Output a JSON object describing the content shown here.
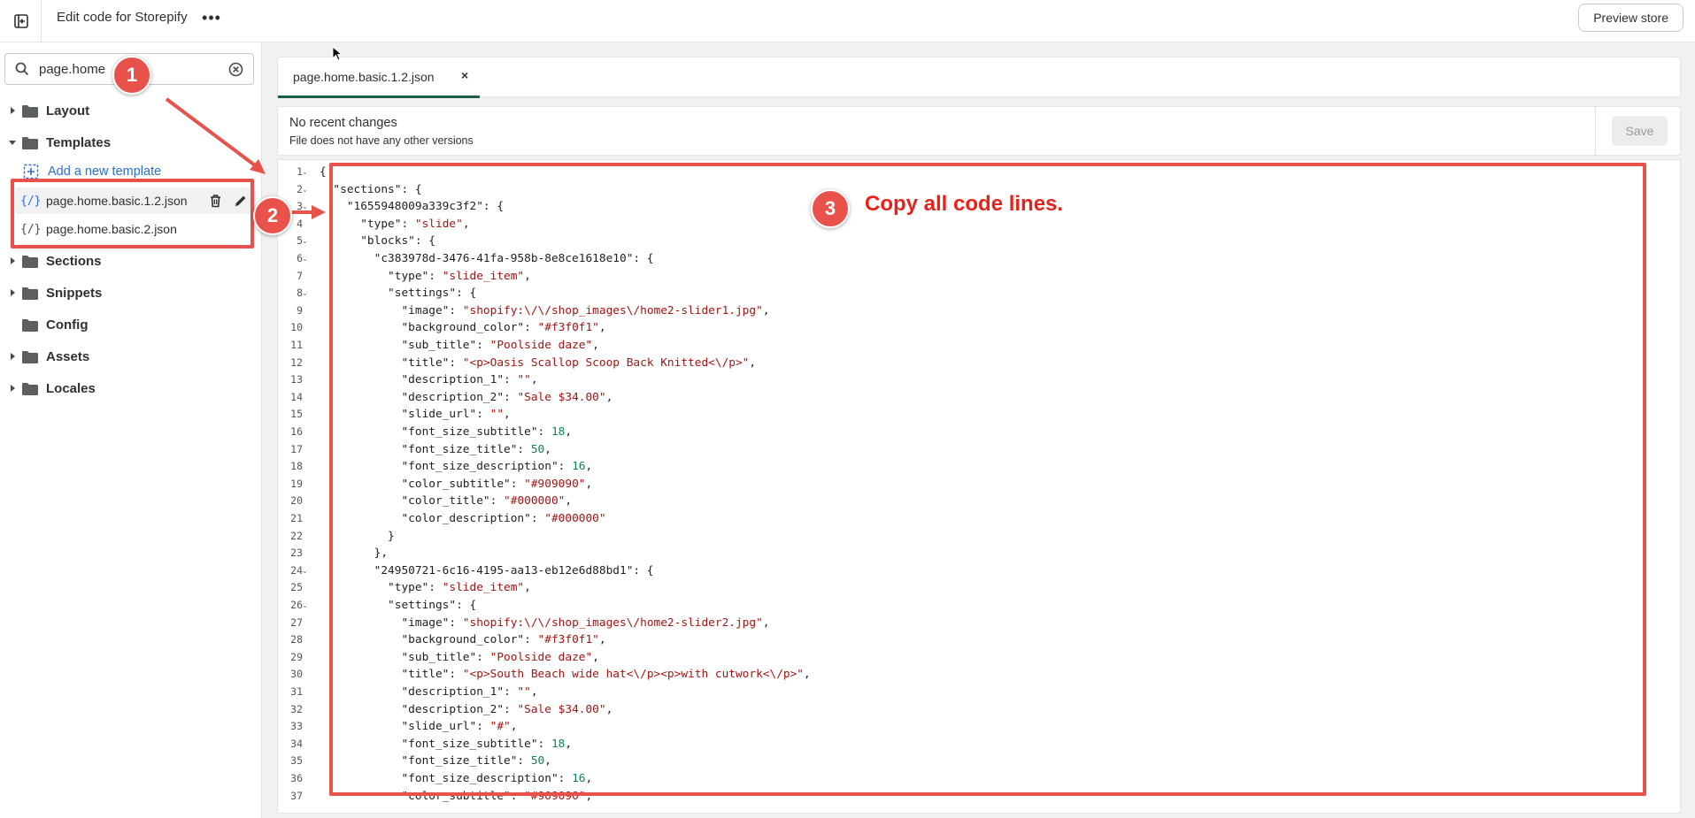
{
  "topbar": {
    "title": "Edit code for Storepify",
    "more_label": "•••",
    "preview_label": "Preview store"
  },
  "sidebar": {
    "search_value": "page.home",
    "folders": [
      {
        "label": "Layout",
        "expanded": false
      },
      {
        "label": "Templates",
        "expanded": true
      },
      {
        "label": "Sections",
        "expanded": false
      },
      {
        "label": "Snippets",
        "expanded": false
      },
      {
        "label": "Config",
        "expanded": false
      },
      {
        "label": "Assets",
        "expanded": false
      },
      {
        "label": "Locales",
        "expanded": false
      }
    ],
    "add_template_label": "Add a new template",
    "files": [
      {
        "icon": "{/}",
        "label": "page.home.basic.1.2.json",
        "active": true
      },
      {
        "icon": "{/}",
        "label": "page.home.basic.2.json",
        "active": false
      }
    ]
  },
  "editor": {
    "tab_label": "page.home.basic.1.2.json",
    "tab_close": "×",
    "info_title": "No recent changes",
    "info_subtitle": "File does not have any other versions",
    "save_label": "Save",
    "folded_lines": [
      1,
      2,
      3,
      5,
      6,
      8,
      24,
      26
    ],
    "lines": [
      "{",
      "  \"sections\": {",
      "    \"1655948009a339c3f2\": {",
      "      \"type\": \"slide\",",
      "      \"blocks\": {",
      "        \"c383978d-3476-41fa-958b-8e8ce1618e10\": {",
      "          \"type\": \"slide_item\",",
      "          \"settings\": {",
      "            \"image\": \"shopify:\\/\\/shop_images\\/home2-slider1.jpg\",",
      "            \"background_color\": \"#f3f0f1\",",
      "            \"sub_title\": \"Poolside daze\",",
      "            \"title\": \"<p>Oasis Scallop Scoop Back Knitted<\\/p>\",",
      "            \"description_1\": \"\",",
      "            \"description_2\": \"Sale $34.00\",",
      "            \"slide_url\": \"\",",
      "            \"font_size_subtitle\": 18,",
      "            \"font_size_title\": 50,",
      "            \"font_size_description\": 16,",
      "            \"color_subtitle\": \"#909090\",",
      "            \"color_title\": \"#000000\",",
      "            \"color_description\": \"#000000\"",
      "          }",
      "        },",
      "        \"24950721-6c16-4195-aa13-eb12e6d88bd1\": {",
      "          \"type\": \"slide_item\",",
      "          \"settings\": {",
      "            \"image\": \"shopify:\\/\\/shop_images\\/home2-slider2.jpg\",",
      "            \"background_color\": \"#f3f0f1\",",
      "            \"sub_title\": \"Poolside daze\",",
      "            \"title\": \"<p>South Beach wide hat<\\/p><p>with cutwork<\\/p>\",",
      "            \"description_1\": \"\",",
      "            \"description_2\": \"Sale $34.00\",",
      "            \"slide_url\": \"#\",",
      "            \"font_size_subtitle\": 18,",
      "            \"font_size_title\": 50,",
      "            \"font_size_description\": 16,",
      "            \"color_subtitle\": \"#909090\","
    ]
  },
  "annotations": {
    "badges": [
      "1",
      "2",
      "3"
    ],
    "instruction": "Copy all code lines.",
    "color": "#e8524a"
  }
}
